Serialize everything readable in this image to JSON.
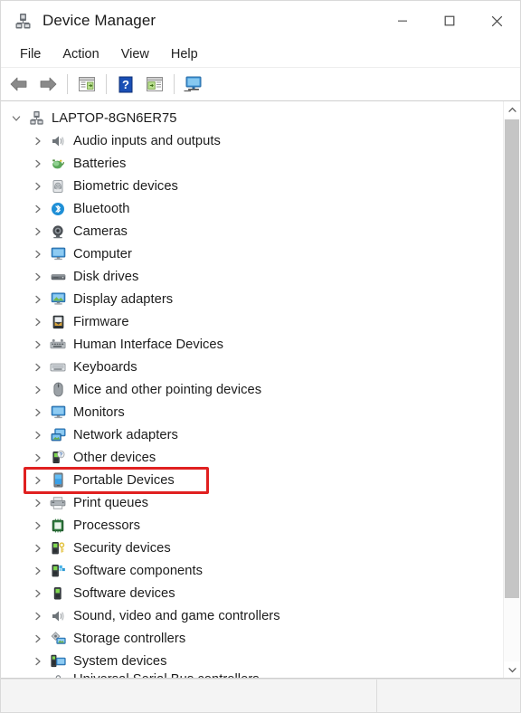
{
  "window": {
    "title": "Device Manager",
    "title_icon": "device-manager-icon"
  },
  "caption": {
    "minimize": "minimize-button",
    "maximize": "maximize-button",
    "close": "close-button"
  },
  "menubar": {
    "items": [
      {
        "label": "File"
      },
      {
        "label": "Action"
      },
      {
        "label": "View"
      },
      {
        "label": "Help"
      }
    ]
  },
  "toolbar": {
    "buttons": [
      {
        "icon": "back-arrow-icon",
        "title": "Back"
      },
      {
        "icon": "forward-arrow-icon",
        "title": "Forward"
      },
      {
        "icon": "properties-icon",
        "title": "Properties"
      },
      {
        "icon": "help-icon",
        "title": "Help"
      },
      {
        "icon": "update-driver-icon",
        "title": "Update driver"
      },
      {
        "icon": "scan-hardware-icon",
        "title": "Scan for hardware changes"
      }
    ]
  },
  "tree": {
    "root": {
      "label": "LAPTOP-8GN6ER75",
      "icon": "computer-root-icon",
      "expanded": true
    },
    "items": [
      {
        "label": "Audio inputs and outputs",
        "icon": "speaker-icon"
      },
      {
        "label": "Batteries",
        "icon": "battery-icon"
      },
      {
        "label": "Biometric devices",
        "icon": "fingerprint-icon"
      },
      {
        "label": "Bluetooth",
        "icon": "bluetooth-icon"
      },
      {
        "label": "Cameras",
        "icon": "camera-icon"
      },
      {
        "label": "Computer",
        "icon": "monitor-icon"
      },
      {
        "label": "Disk drives",
        "icon": "disk-drive-icon"
      },
      {
        "label": "Display adapters",
        "icon": "display-adapter-icon"
      },
      {
        "label": "Firmware",
        "icon": "firmware-icon"
      },
      {
        "label": "Human Interface Devices",
        "icon": "hid-icon"
      },
      {
        "label": "Keyboards",
        "icon": "keyboard-icon"
      },
      {
        "label": "Mice and other pointing devices",
        "icon": "mouse-icon"
      },
      {
        "label": "Monitors",
        "icon": "monitor-icon"
      },
      {
        "label": "Network adapters",
        "icon": "network-adapter-icon"
      },
      {
        "label": "Other devices",
        "icon": "other-devices-warning-icon"
      },
      {
        "label": "Portable Devices",
        "icon": "portable-device-icon",
        "highlighted": true
      },
      {
        "label": "Print queues",
        "icon": "printer-icon"
      },
      {
        "label": "Processors",
        "icon": "processor-icon"
      },
      {
        "label": "Security devices",
        "icon": "security-device-icon"
      },
      {
        "label": "Software components",
        "icon": "software-component-icon"
      },
      {
        "label": "Software devices",
        "icon": "software-device-icon"
      },
      {
        "label": "Sound, video and game controllers",
        "icon": "speaker-icon"
      },
      {
        "label": "Storage controllers",
        "icon": "storage-controller-icon"
      },
      {
        "label": "System devices",
        "icon": "system-device-icon"
      },
      {
        "label": "Universal Serial Bus controllers",
        "icon": "usb-controller-icon"
      }
    ]
  },
  "annotation": {
    "target_label": "Portable Devices",
    "color": "#e02020"
  },
  "scrollbar": {
    "up": "scroll-up-arrow-icon",
    "down": "scroll-down-arrow-icon",
    "thumb": "scrollbar-thumb"
  },
  "statusbar": {
    "text": ""
  }
}
